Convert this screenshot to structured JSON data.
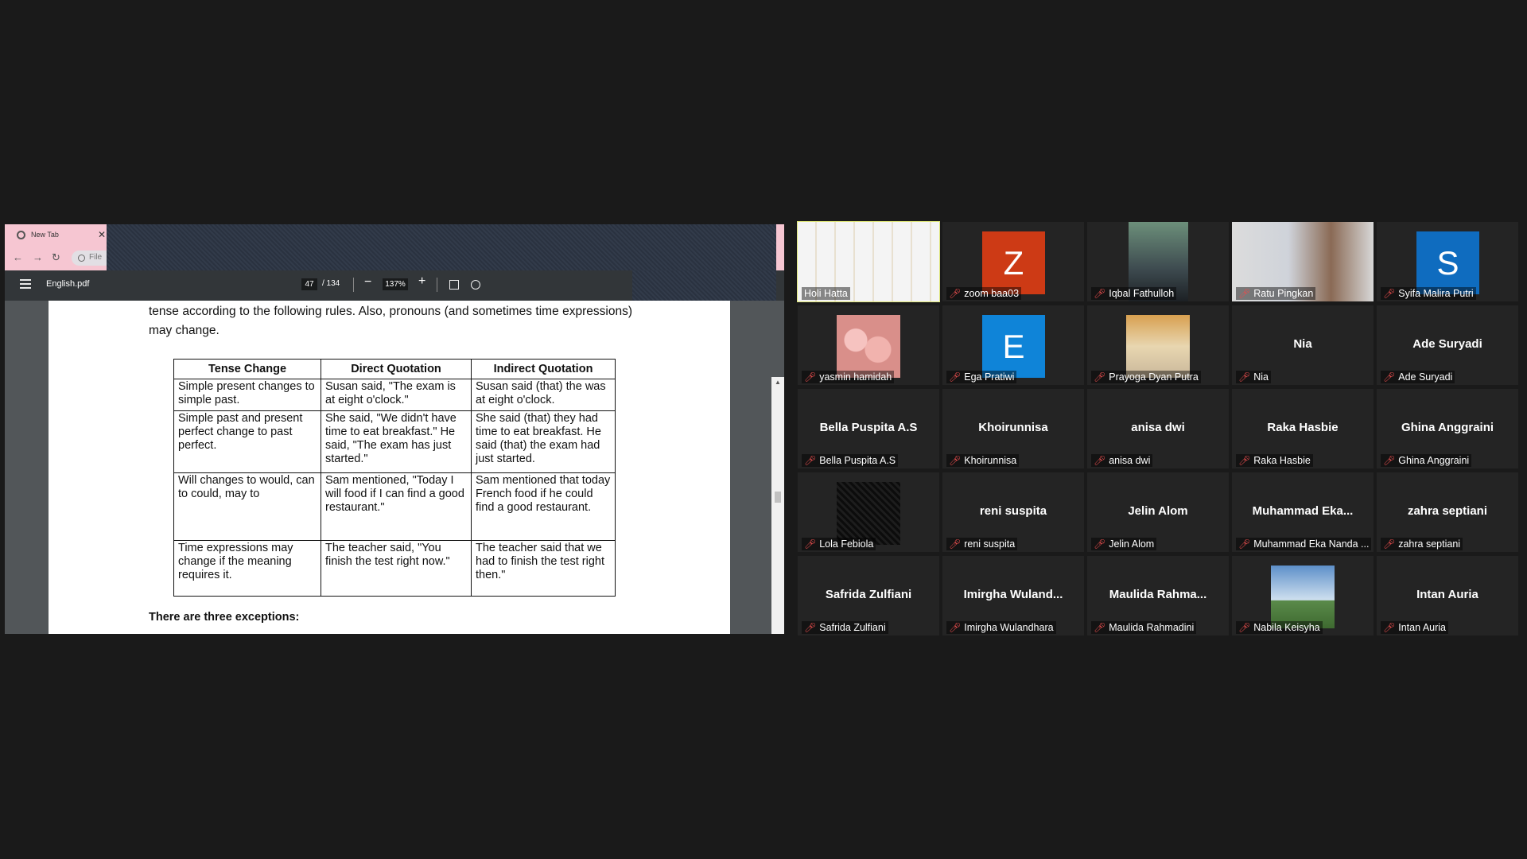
{
  "browser": {
    "tab_title": "New Tab",
    "tab_close": "✕",
    "nav_back": "←",
    "nav_forward": "→",
    "nav_reload": "↻",
    "address_text": "File"
  },
  "pdf_toolbar": {
    "file_name": "English.pdf",
    "current_page": "47",
    "total_pages": "/ 134",
    "zoom_out": "−",
    "zoom_level": "137%",
    "zoom_in": "+"
  },
  "pdf_page": {
    "intro_text": "tense according to the following rules. Also, pronouns (and sometimes time expressions) may change.",
    "table": {
      "headers": [
        "Tense Change",
        "Direct Quotation",
        "Indirect Quotation"
      ],
      "rows": [
        [
          "Simple present changes to simple past.",
          "Susan said, \"The exam is at eight o'clock.\"",
          "Susan said (that) the was at eight o'clock."
        ],
        [
          "Simple past and present perfect change to past perfect.",
          "She said, \"We didn't have time to eat breakfast.\" He said, \"The exam has just started.\"",
          "She said (that) they had time to eat breakfast. He said (that) the exam had just started."
        ],
        [
          "Will changes to would, can to could, may to",
          "Sam mentioned, \"Today I will food if I can find a good restaurant.\"",
          "Sam mentioned that today French food if he could find a good restaurant."
        ],
        [
          "Time expressions may change if the meaning requires it.",
          "The teacher said, \"You finish the test right now.\"",
          "The teacher said that we had to finish the test right then.\""
        ]
      ]
    },
    "footer_heading": "There are three exceptions:"
  },
  "gallery": [
    {
      "display": "",
      "label": "Holi Hatta",
      "type": "video",
      "active": true
    },
    {
      "display": "Z",
      "label": "zoom baa03",
      "type": "avatar",
      "color": "#cd3a15"
    },
    {
      "display": "",
      "label": "Iqbal Fathulloh",
      "type": "video"
    },
    {
      "display": "",
      "label": "Ratu Pingkan",
      "type": "video"
    },
    {
      "display": "S",
      "label": "Syifa Malira Putri",
      "type": "avatar",
      "color": "#0f6cbf"
    },
    {
      "display": "",
      "label": "yasmin hamidah",
      "type": "photo-flowers"
    },
    {
      "display": "E",
      "label": "Ega Pratiwi",
      "type": "avatar",
      "color": "#0f84d8"
    },
    {
      "display": "",
      "label": "Prayoga Dyan Putra",
      "type": "photo"
    },
    {
      "display": "Nia",
      "label": "Nia",
      "type": "name"
    },
    {
      "display": "Ade Suryadi",
      "label": "Ade Suryadi",
      "type": "name"
    },
    {
      "display": "Bella Puspita A.S",
      "label": "Bella Puspita A.S",
      "type": "name"
    },
    {
      "display": "Khoirunnisa",
      "label": "Khoirunnisa",
      "type": "name"
    },
    {
      "display": "anisa dwi",
      "label": "anisa dwi",
      "type": "name"
    },
    {
      "display": "Raka Hasbie",
      "label": "Raka Hasbie",
      "type": "name"
    },
    {
      "display": "Ghina Anggraini",
      "label": "Ghina Anggraini",
      "type": "name"
    },
    {
      "display": "",
      "label": "Lola Febiola",
      "type": "photo-dark"
    },
    {
      "display": "reni suspita",
      "label": "reni suspita",
      "type": "name"
    },
    {
      "display": "Jelin Alom",
      "label": "Jelin Alom",
      "type": "name"
    },
    {
      "display": "Muhammad Eka...",
      "label": "Muhammad Eka Nanda ...",
      "type": "name"
    },
    {
      "display": "zahra septiani",
      "label": "zahra septiani",
      "type": "name"
    },
    {
      "display": "Safrida Zulfiani",
      "label": "Safrida Zulfiani",
      "type": "name"
    },
    {
      "display": "Imirgha Wuland...",
      "label": "Imirgha Wulandhara",
      "type": "name"
    },
    {
      "display": "Maulida Rahma...",
      "label": "Maulida Rahmadini",
      "type": "name"
    },
    {
      "display": "",
      "label": "Nabila Keisyha",
      "type": "photo-sky"
    },
    {
      "display": "Intan Auria",
      "label": "Intan Auria",
      "type": "name"
    }
  ]
}
